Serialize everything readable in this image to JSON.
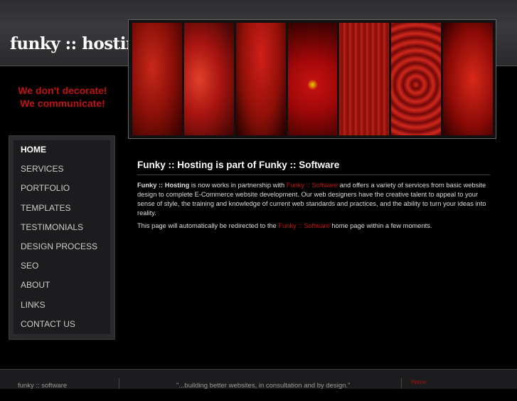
{
  "header": {
    "logo": "funky :: hosting"
  },
  "tagline": {
    "line1": "We don't decorate!",
    "line2": "We communicate!"
  },
  "nav": {
    "items": [
      "HOME",
      "SERVICES",
      "PORTFOLIO",
      "TEMPLATES",
      "TESTIMONIALS",
      "DESIGN PROCESS",
      "SEO",
      "ABOUT",
      "LINKS",
      "CONTACT US"
    ],
    "active": "HOME"
  },
  "content": {
    "title": "Funky :: Hosting is part of Funky :: Software",
    "p1_bold": "Funky :: Hosting",
    "p1_a": " is now works in partnership with ",
    "p1_link": "Funky :: Software",
    "p1_b": " and offers a variety of services from basic website design to complete E-Commerce website development. Our web designers have the creative talent to appeal to your sense of style, the training and knowledge of current web standards and practices, and the ability to turn your ideas into reality.",
    "p2_a": "This page will automatically be redirected to the ",
    "p2_link": "Funky :: Software",
    "p2_b": " home page within a few moments."
  },
  "footer": {
    "left": "funky :: software",
    "center": "\"...building better websites, in consultation and by design.\"",
    "right": "Home"
  },
  "colors": {
    "accent": "#c01414",
    "background": "#000000"
  }
}
